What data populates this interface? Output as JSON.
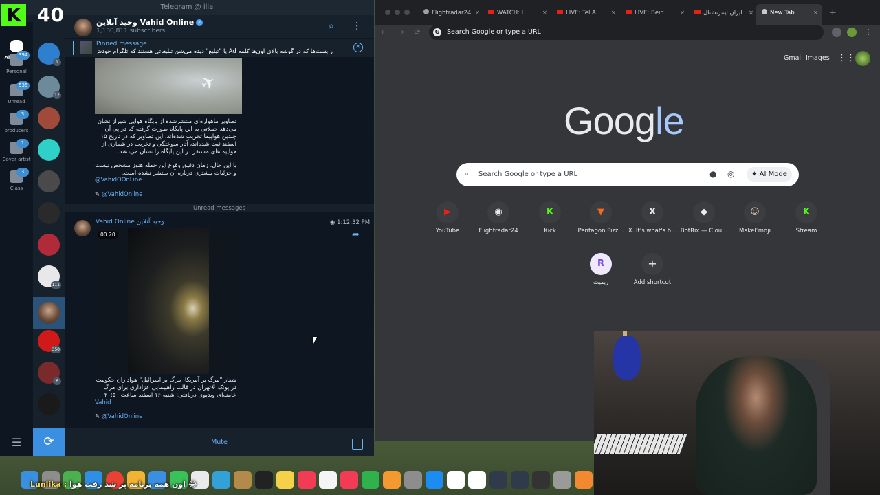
{
  "telegram": {
    "window_title": "Telegram @ illa",
    "stream_badge": {
      "letter": "K",
      "count": "40"
    },
    "folders": [
      {
        "label": "All Chats",
        "badge": "",
        "icon": "chat-bubbles-icon",
        "active": true
      },
      {
        "label": "Personal",
        "badge": "394",
        "icon": "person-icon"
      },
      {
        "label": "Unread",
        "badge": "535",
        "icon": "unread-icon"
      },
      {
        "label": "producers",
        "badge": "3",
        "icon": "folder-icon"
      },
      {
        "label": "Cover artist",
        "badge": "1",
        "icon": "folder-icon"
      },
      {
        "label": "Class",
        "badge": "3",
        "icon": "folder-icon"
      }
    ],
    "chat_badges": [
      "1",
      "12",
      "111",
      "350",
      "6"
    ],
    "header": {
      "title": "وحید آنلاین Vahid Online",
      "subscribers": "1,130,811 subscribers"
    },
    "pinned": {
      "title": "Pinned message",
      "text": "ر پست‌ها که در گوشه بالای اون‌ها کلمه Ad یا \"تبلیغ\" دیده می‌شن تبلیغاتی هستند که تلگرام خودش ..."
    },
    "messages": {
      "m1_text": "تصاویر ماهواره‌ای منتشرشده از پایگاه هوایی شیراز نشان می‌دهد حملاتی به این پایگاه صورت گرفته که در پی آن چندین هواپیما تخریب شده‌اند. این تصاویر که در تاریخ ۱۵ اسفند ثبت شده‌اند، آثار سوختگی و تخریب در شماری از هواپیماهای مستقر در این پایگاه را نشان می‌دهند.",
      "m1_text2": "با این حال، زمان دقیق وقوع این حمله هنوز مشخص نیست و جزئیات بیشتری درباره آن منتشر نشده است.",
      "m1_mention": "@VahidOOnLine",
      "m1_link": "@VahidOnline",
      "unread_separator": "Unread messages",
      "m2_author": "Vahid Online وحید آنلاین",
      "m2_time": "1:12:32 PM",
      "m2_duration": "00:20",
      "m2_text": "شعار \"مرگ بر آمریکا، مرگ بر اسرائیل\" هواداران حکومت در پونک #تهران در قالب راهپیمایی عزاداری برای مرگ خامنه‌ای ویدیوی دریافتی: شنبه ۱۶ اسفند ساعت ۲۰:۵۰",
      "m2_signature": "Vahid",
      "m2_link": "@VahidOnline"
    },
    "footer": {
      "mute_label": "Mute"
    }
  },
  "chrome": {
    "tabs": [
      {
        "title": "Flightradar24",
        "icon": "flightradar-icon"
      },
      {
        "title": "WATCH: I",
        "icon": "youtube-icon"
      },
      {
        "title": "LIVE: Tel A",
        "icon": "youtube-icon"
      },
      {
        "title": "LIVE: Bein",
        "icon": "youtube-icon"
      },
      {
        "title": "ایران اینترنشنال",
        "icon": "youtube-icon"
      },
      {
        "title": "New Tab",
        "icon": "chrome-icon",
        "active": true
      }
    ],
    "omnibox_placeholder": "Search Google or type a URL",
    "ntp": {
      "links": [
        "Gmail",
        "Images"
      ],
      "logo": "Google",
      "search_placeholder": "Search Google or type a URL",
      "ai_mode_label": "AI Mode",
      "shortcuts": [
        {
          "label": "YouTube",
          "glyph": "▶",
          "color": "#e62117"
        },
        {
          "label": "Flightradar24",
          "glyph": "◉",
          "color": "#e8eaed"
        },
        {
          "label": "Kick",
          "glyph": "K",
          "color": "#53fc18"
        },
        {
          "label": "Pentagon Pizz...",
          "glyph": "▼",
          "color": "#f26b1d"
        },
        {
          "label": "X. It's what's h...",
          "glyph": "X",
          "color": "#e8eaed"
        },
        {
          "label": "BotRix — Clou...",
          "glyph": "◆",
          "color": "#e8eaed"
        },
        {
          "label": "MakeEmoji",
          "glyph": "☺",
          "color": "#d9c7a8"
        },
        {
          "label": "Stream",
          "glyph": "K",
          "color": "#53fc18"
        },
        {
          "label": "ریمیت",
          "glyph": "R",
          "color": "#7a4dd8"
        },
        {
          "label": "Add shortcut",
          "glyph": "+",
          "color": "#e8eaed"
        }
      ]
    }
  },
  "stream_chat": {
    "nick": "Lunlika :",
    "message": "اون همه برنامه پر شد رفت هوا 😂"
  },
  "dock_icons": [
    {
      "name": "finder-icon",
      "color": "#3a8fe0"
    },
    {
      "name": "launchpad-icon",
      "color": "#8d8d8d"
    },
    {
      "name": "maps-icon",
      "color": "#4caf50"
    },
    {
      "name": "safari-icon",
      "color": "#2f8ee5"
    },
    {
      "name": "chrome-icon",
      "color": "#e94235"
    },
    {
      "name": "photos-icon",
      "color": "#f2b233"
    },
    {
      "name": "mail-icon",
      "color": "#3a8fe0"
    },
    {
      "name": "facetime-icon",
      "color": "#3ac25a"
    },
    {
      "name": "reminders-icon",
      "color": "#eaeaea"
    },
    {
      "name": "weather-icon",
      "color": "#34a0d8"
    },
    {
      "name": "files-icon",
      "color": "#b48a4a"
    },
    {
      "name": "appletv-icon",
      "color": "#222222"
    },
    {
      "name": "notes-icon",
      "color": "#f5d14a"
    },
    {
      "name": "music-icon",
      "color": "#f23c56"
    },
    {
      "name": "calendar-icon",
      "color": "#f5f5f5"
    },
    {
      "name": "news-icon",
      "color": "#f23c56"
    },
    {
      "name": "numbers-icon",
      "color": "#2fb24c"
    },
    {
      "name": "pages-icon",
      "color": "#f29a2f"
    },
    {
      "name": "settings-icon",
      "color": "#8d8d8d"
    },
    {
      "name": "appstore-icon",
      "color": "#1d8cf2"
    },
    {
      "name": "notion-icon",
      "color": "#ffffff"
    },
    {
      "name": "calendar31-icon",
      "color": "#ffffff"
    },
    {
      "name": "tool-icon",
      "color": "#2f3a4a"
    },
    {
      "name": "tool2-icon",
      "color": "#2f3a4a"
    },
    {
      "name": "obs-icon",
      "color": "#333333"
    },
    {
      "name": "disk-icon",
      "color": "#9a9a9a"
    },
    {
      "name": "flstudio-icon",
      "color": "#f2882f"
    }
  ]
}
